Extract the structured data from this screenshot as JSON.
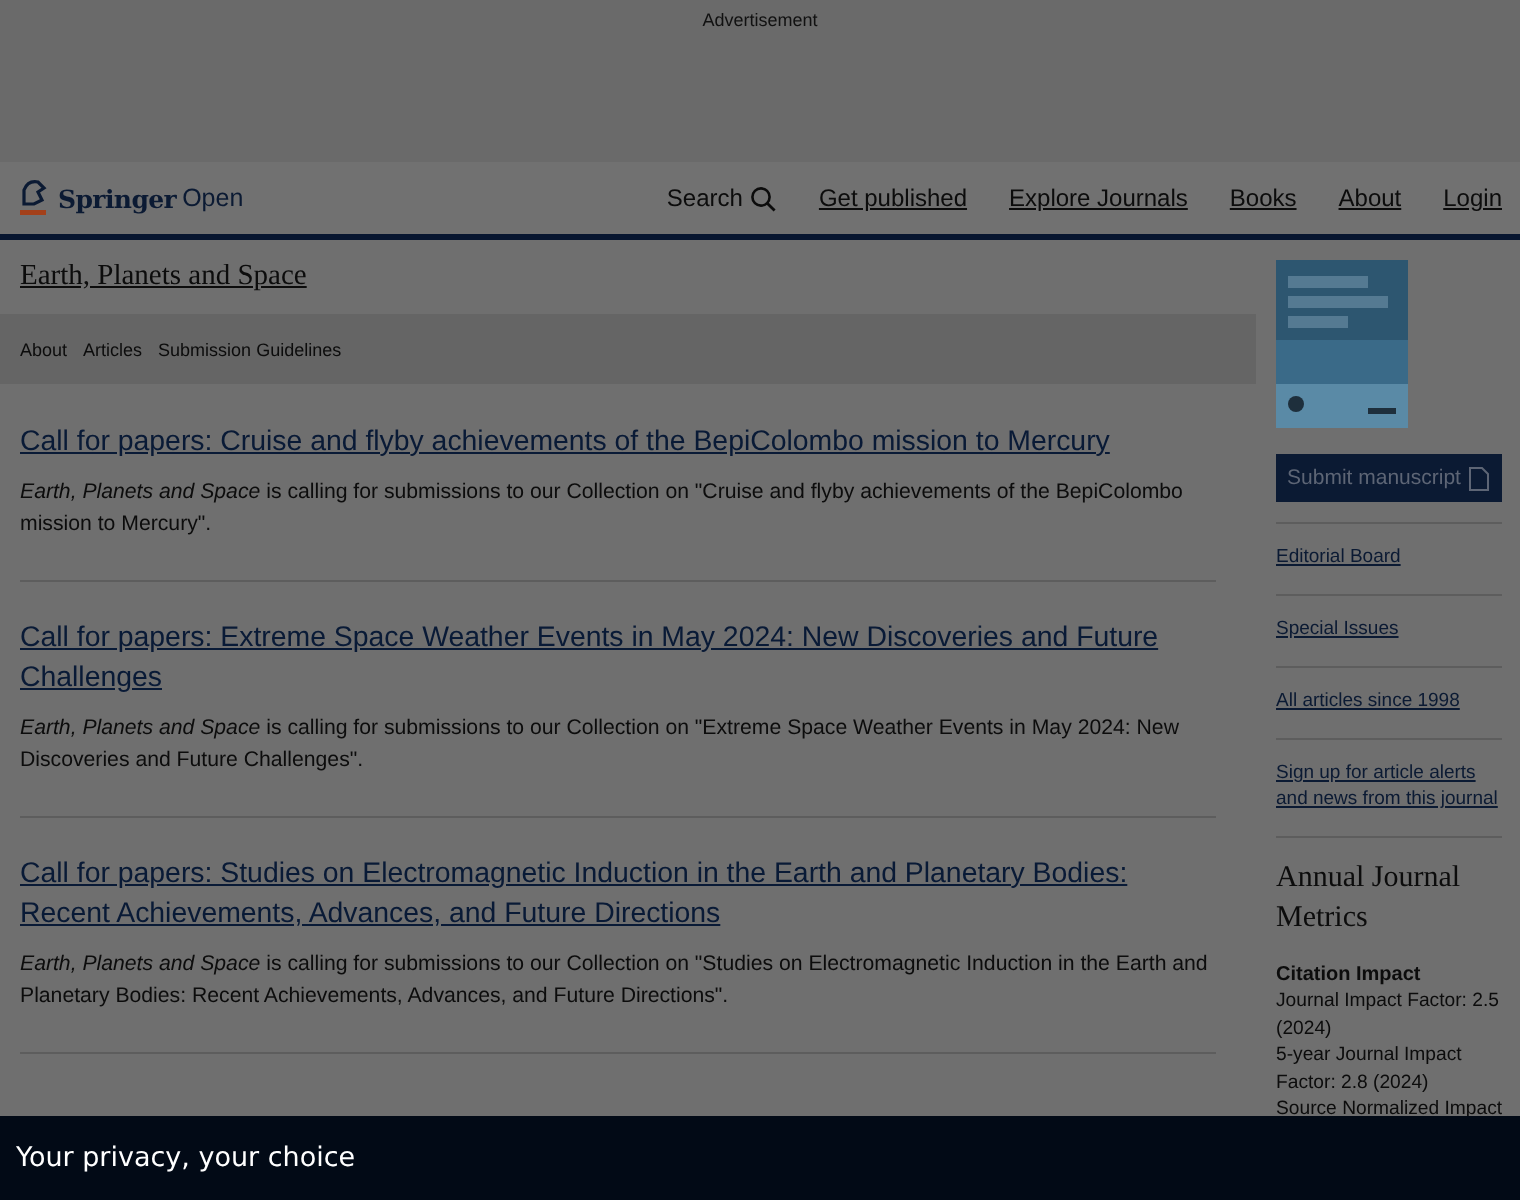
{
  "ad": {
    "label": "Advertisement"
  },
  "header": {
    "brand": {
      "name": "Springer",
      "suffix": "Open"
    },
    "search": "Search",
    "nav": [
      "Get published",
      "Explore Journals",
      "Books",
      "About",
      "Login"
    ]
  },
  "journal": {
    "title": "Earth, Planets and Space",
    "nav": [
      "About",
      "Articles",
      "Submission Guidelines"
    ]
  },
  "articles": [
    {
      "title": "Call for papers: Cruise and flyby achievements of the BepiColombo mission to Mercury",
      "summary": "*Earth, Planets and Space* is calling for submissions to our Collection on \"Cruise and flyby achievements of the BepiColombo mission to Mercury\"."
    },
    {
      "title": "Call for papers: Extreme Space Weather Events in May 2024: New Discoveries and Future Challenges",
      "summary": "*Earth, Planets and Space* is calling for submissions to our Collection on \"Extreme Space Weather Events in May 2024: New Discoveries and Future Challenges\"."
    },
    {
      "title": "Call for papers: Studies on Electromagnetic Induction in the Earth and Planetary Bodies: Recent Achievements, Advances, and Future Directions",
      "summary": "*Earth, Planets and Space* is calling for submissions to our Collection on \"Studies on Electromagnetic Induction in the Earth and Planetary Bodies: Recent Achievements, Advances, and Future Directions\"."
    }
  ],
  "sidebar": {
    "cover": {
      "kind": "picture"
    },
    "submit": "Submit manuscript",
    "links": [
      "Editorial Board",
      "Special Issues",
      "All articles since 1998",
      "Sign up for article alerts and news from this journal"
    ],
    "metrics": {
      "title": "Annual Journal Metrics",
      "subtitle": "Citation Impact",
      "lines": [
        "Journal Impact Factor: 2.5 (2024)",
        "5-year Journal Impact Factor: 2.8 (2024)",
        "Source Normalized Impact"
      ]
    }
  },
  "privacy": {
    "title": "Your privacy, your choice"
  }
}
